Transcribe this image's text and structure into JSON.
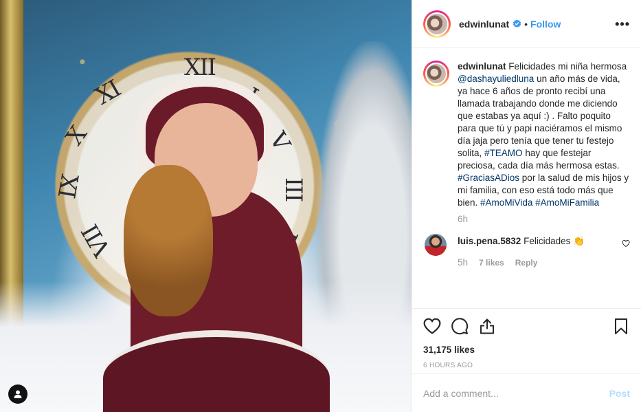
{
  "post": {
    "author": "edwinlunat",
    "follow_label": "Follow",
    "separator": "•",
    "more_label": "•••",
    "caption": {
      "username": "edwinlunat",
      "p1": "Felicidades mi niña hermosa",
      "mention": "@dashayuliedluna",
      "p2": "un año más de vida, ya hace 6 años de pronto recibí una llamada trabajando donde me diciendo que estabas ya aquí :) . Falto poquito para que tú y papi naciéramos el mismo día jaja pero tenía que tener tu festejo solita,",
      "tag1": "#TEAMO",
      "p3": "hay que festejar preciosa, cada día más hermosa estas.",
      "tag2": "#GraciasADios",
      "p4": "por la salud de mis hijos y mi familia, con eso está todo más que bien.",
      "tag3": "#AmoMiVida",
      "tag4": "#AmoMiFamilia",
      "time": "6h"
    },
    "comment": {
      "username": "luis.pena.5832",
      "text": "Felicidades",
      "emoji": "👏",
      "time": "5h",
      "likes": "7 likes",
      "reply_label": "Reply"
    },
    "likes": "31,175 likes",
    "posted_ago": "6 HOURS AGO",
    "add_comment_placeholder": "Add a comment...",
    "post_button": "Post",
    "photo": {
      "numerals": [
        "XII",
        "I",
        "XI",
        "IX",
        "X",
        "III",
        "VII",
        "V",
        "IIII"
      ]
    }
  },
  "colors": {
    "link": "#003569",
    "follow": "#3897f0",
    "muted": "#999999",
    "post_disabled": "#b2dffc",
    "verified": "#3897f0"
  },
  "icons": [
    "user-tag-icon",
    "verified-icon",
    "more-options-icon",
    "like-heart-icon",
    "comment-icon",
    "share-icon",
    "save-bookmark-icon",
    "comment-like-icon"
  ]
}
